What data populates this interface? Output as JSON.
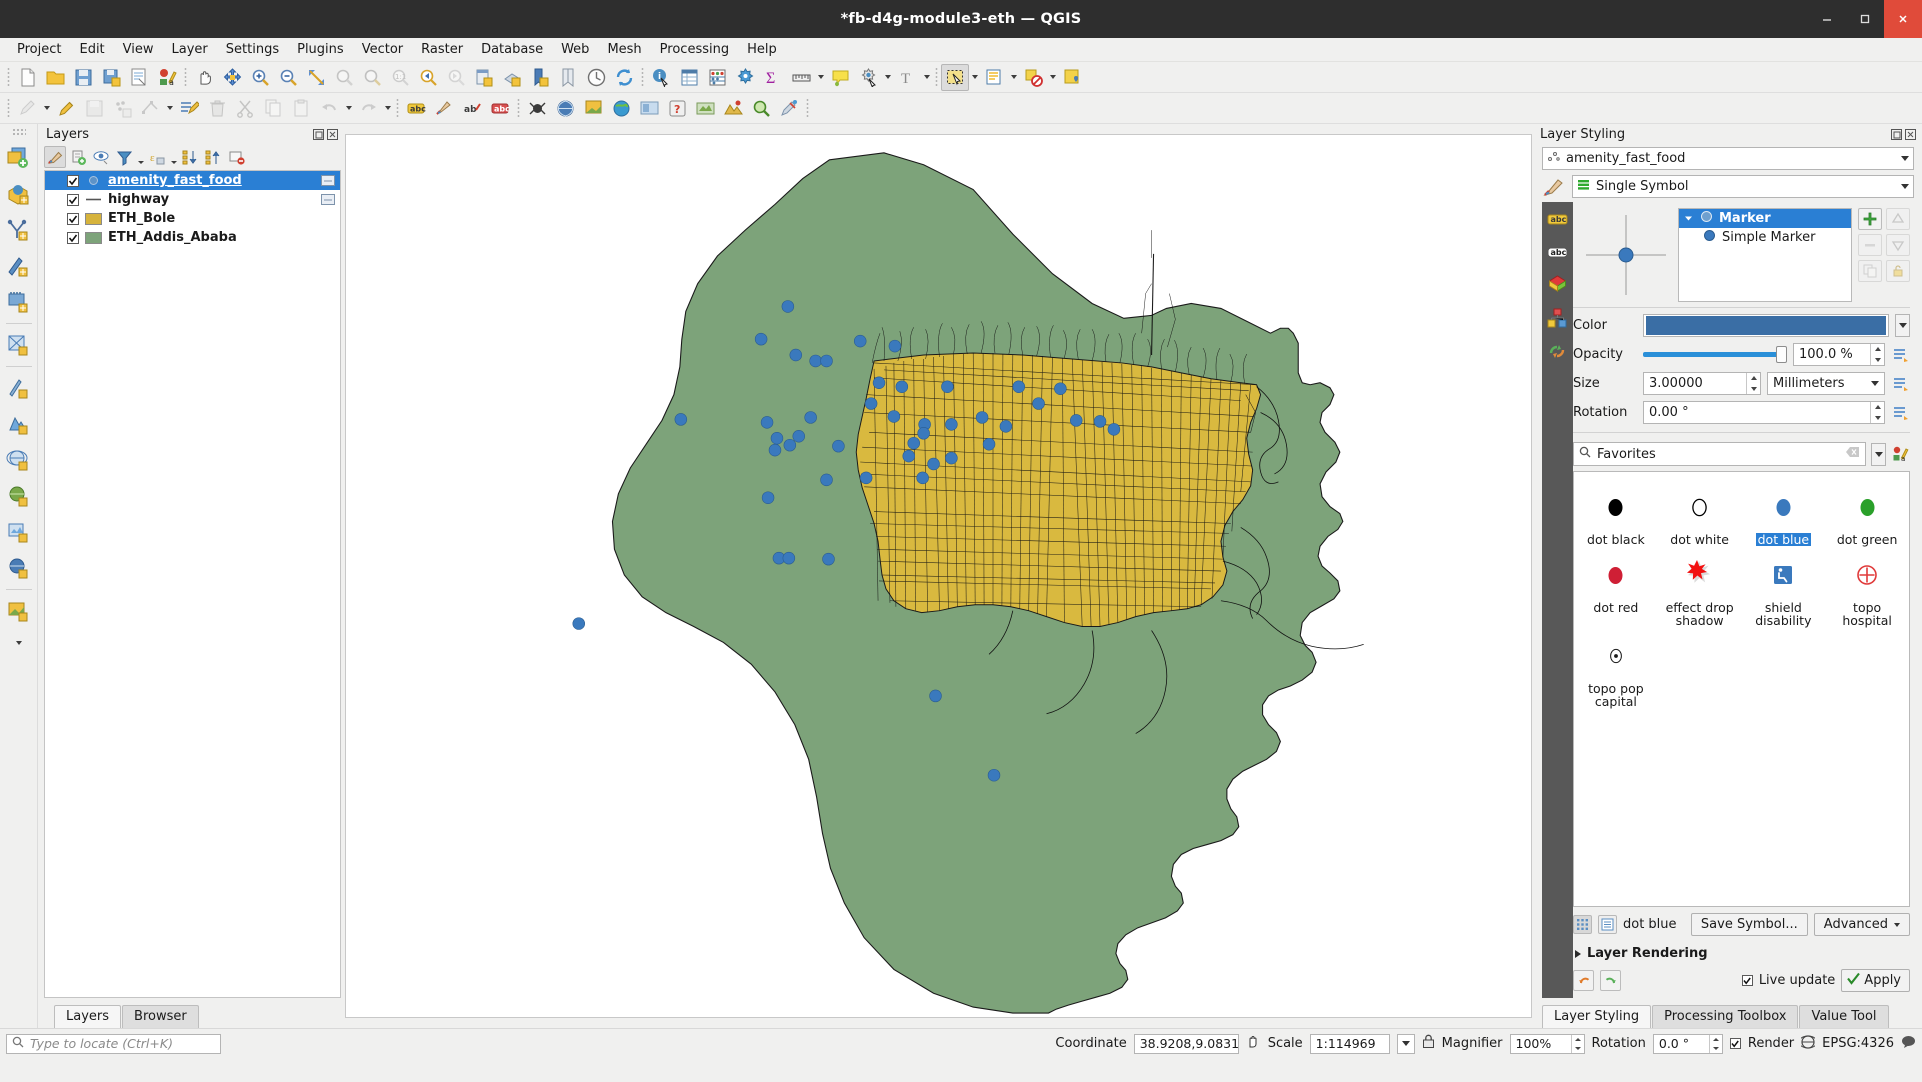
{
  "window": {
    "title": "*fb-d4g-module3-eth — QGIS",
    "minimize": "–",
    "maximize": "□",
    "close": "✕"
  },
  "menubar": [
    {
      "label": "Project",
      "accel": "P"
    },
    {
      "label": "Edit",
      "accel": "E"
    },
    {
      "label": "View",
      "accel": "V"
    },
    {
      "label": "Layer",
      "accel": "L"
    },
    {
      "label": "Settings",
      "accel": "S"
    },
    {
      "label": "Plugins",
      "accel": "P"
    },
    {
      "label": "Vector",
      "accel": "o"
    },
    {
      "label": "Raster",
      "accel": "R"
    },
    {
      "label": "Database",
      "accel": "D"
    },
    {
      "label": "Web",
      "accel": "W"
    },
    {
      "label": "Mesh",
      "accel": "M"
    },
    {
      "label": "Processing",
      "accel": "c"
    },
    {
      "label": "Help",
      "accel": "H"
    }
  ],
  "layers_panel": {
    "title": "Layers",
    "toolbar": [
      "style-manager-icon",
      "add-group-icon",
      "visibility-icon",
      "filter-icon",
      "expression-icon",
      "collapse-all-icon",
      "expand-all-icon",
      "remove-layer-icon"
    ],
    "items": [
      {
        "name": "amenity_fast_food",
        "type": "point",
        "color": "#3a6ea5",
        "checked": true,
        "selected": true
      },
      {
        "name": "highway",
        "type": "line",
        "color": "#555555",
        "checked": true,
        "selected": false
      },
      {
        "name": "ETH_Bole",
        "type": "polygon",
        "color": "#d6b33c",
        "checked": true,
        "selected": false
      },
      {
        "name": "ETH_Addis_Ababa",
        "type": "polygon",
        "color": "#7da37a",
        "checked": true,
        "selected": false
      }
    ],
    "tabs": [
      {
        "label": "Layers",
        "active": true
      },
      {
        "label": "Browser",
        "active": false
      }
    ]
  },
  "style_panel": {
    "title": "Layer Styling",
    "layer_combo": "amenity_fast_food",
    "renderer_combo": "Single Symbol",
    "symbol_tree": [
      {
        "label": "Marker",
        "level": 0,
        "selected": true
      },
      {
        "label": "Simple Marker",
        "level": 1,
        "selected": false
      }
    ],
    "properties": {
      "color_label": "Color",
      "color_value": "#3a6ea5",
      "opacity_label": "Opacity",
      "opacity_value": "100.0 %",
      "size_label": "Size",
      "size_value": "3.00000",
      "size_unit": "Millimeters",
      "rotation_label": "Rotation",
      "rotation_value": "0.00 °"
    },
    "search_placeholder": "Favorites",
    "gallery": [
      {
        "label": "dot  black",
        "icon": "dot",
        "color": "#000000",
        "selected": false
      },
      {
        "label": "dot  white",
        "icon": "dot-outline",
        "color": "#ffffff",
        "selected": false
      },
      {
        "label": "dot blue",
        "icon": "dot",
        "color": "#3a79bd",
        "selected": true
      },
      {
        "label": "dot green",
        "icon": "dot",
        "color": "#2aa02a",
        "selected": false
      },
      {
        "label": "dot red",
        "icon": "dot",
        "color": "#cf1f35",
        "selected": false
      },
      {
        "label": "effect drop shadow",
        "icon": "starburst",
        "color": "#f21111",
        "selected": false
      },
      {
        "label": "shield disability",
        "icon": "disability",
        "color": "#3a79bd",
        "selected": false
      },
      {
        "label": "topo hospital",
        "icon": "hospital-cross",
        "color": "#e03a3a",
        "selected": false
      },
      {
        "label": "topo pop capital",
        "icon": "pop-capital",
        "color": "#000000",
        "selected": false
      }
    ],
    "footer": {
      "current_symbol": "dot blue",
      "save_symbol": "Save Symbol...",
      "advanced": "Advanced",
      "layer_rendering": "Layer Rendering",
      "live_update": "Live update",
      "apply": "Apply"
    },
    "tabs": [
      {
        "label": "Layer Styling",
        "active": true
      },
      {
        "label": "Processing Toolbox",
        "active": false
      },
      {
        "label": "Value Tool",
        "active": false
      }
    ]
  },
  "statusbar": {
    "locator_placeholder": "Type to locate (Ctrl+K)",
    "coordinate_label": "Coordinate",
    "coordinate_value": "38.9208,9.0831",
    "scale_label": "Scale",
    "scale_value": "1:114969",
    "magnifier_label": "Magnifier",
    "magnifier_value": "100%",
    "rotation_label": "Rotation",
    "rotation_value": "0.0 °",
    "render_label": "Render",
    "crs_label": "EPSG:4326"
  },
  "map": {
    "addis_color": "#7da37a",
    "bole_color": "#d6b33c",
    "point_color": "#3a79bd",
    "outline_color": "#1a1a1a"
  }
}
